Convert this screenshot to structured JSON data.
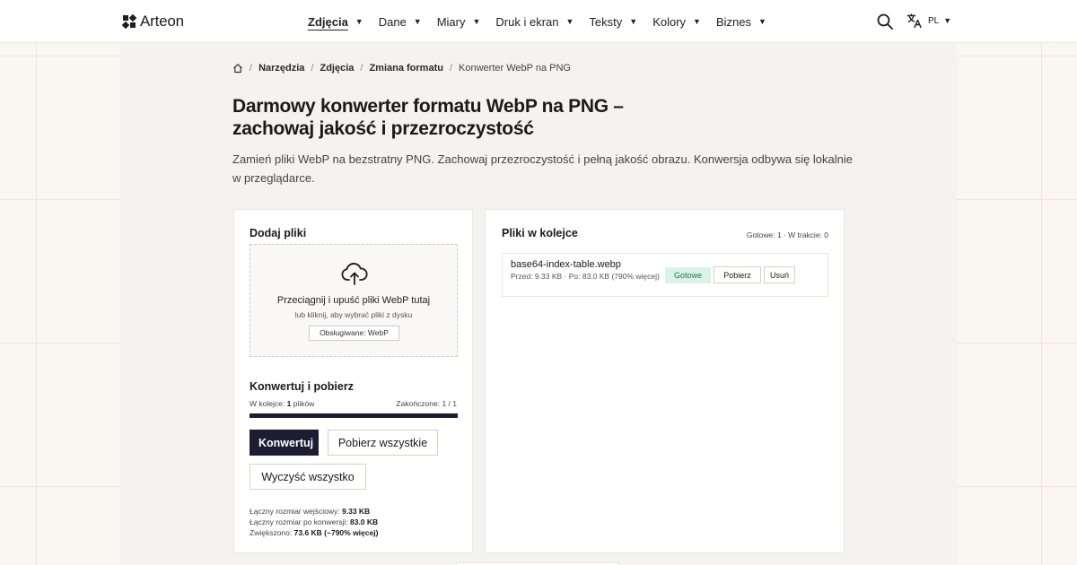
{
  "app": {
    "logo_text": "Arteon"
  },
  "nav": {
    "items": [
      {
        "label": "Zdjęcia",
        "active": true
      },
      {
        "label": "Dane"
      },
      {
        "label": "Miary"
      },
      {
        "label": "Druk i ekran"
      },
      {
        "label": "Teksty"
      },
      {
        "label": "Kolory"
      },
      {
        "label": "Biznes"
      }
    ],
    "caret": "▼",
    "language": "PL"
  },
  "breadcrumb": {
    "sep": "/",
    "items": [
      "Narzędzia",
      "Zdjęcia",
      "Zmiana formatu"
    ],
    "current": "Konwerter WebP na PNG"
  },
  "page": {
    "title": "Darmowy konwerter formatu WebP na PNG – zachowaj jakość i przezroczystość",
    "description": "Zamień pliki WebP na bezstratny PNG. Zachowaj przezroczystość i pełną jakość obrazu. Konwersja odbywa się lokalnie w przeglądarce."
  },
  "upload": {
    "title": "Dodaj pliki",
    "drop_text": "Przeciągnij i upuść pliki WebP tutaj",
    "click_text": "lub kliknij, aby wybrać pliki z dysku",
    "supported": "Obsługiwane: WebP"
  },
  "convert": {
    "title": "Konwertuj i pobierz",
    "queue_label": "W kolejce:",
    "queue_count": "1",
    "queue_unit": "plików",
    "done_label": "Zakończone: 1 / 1",
    "progress": 1.0,
    "convert_label": "Konwertuj",
    "download_all_label": "Pobierz wszystkie",
    "clear_label": "Wyczyść wszystko",
    "summary": {
      "input_label": "Łączny rozmiar wejściowy:",
      "input_value": "9.33 KB",
      "output_label": "Łączny rozmiar po konwersji:",
      "output_value": "83.0 KB",
      "diff_label": "Zwiększono:",
      "diff_value": "73.6 KB (~790% więcej)"
    }
  },
  "queue": {
    "title": "Pliki w kolejce",
    "summary": "Gotowe: 1 · W trakcie: 0",
    "files": [
      {
        "name": "base64-index-table.webp",
        "meta": "Przed: 9.33 KB · Po: 83.0 KB (790% więcej)",
        "status": "Gotowe",
        "download_label": "Pobierz",
        "remove_label": "Usuń"
      }
    ]
  },
  "colors": {
    "accent": "#1c1d33",
    "success_bg": "#daf3e6",
    "success_text": "#1d7a4c"
  },
  "icons": [
    "logo-mark",
    "search-icon",
    "translate-icon",
    "home-icon",
    "upload-cloud-icon"
  ]
}
